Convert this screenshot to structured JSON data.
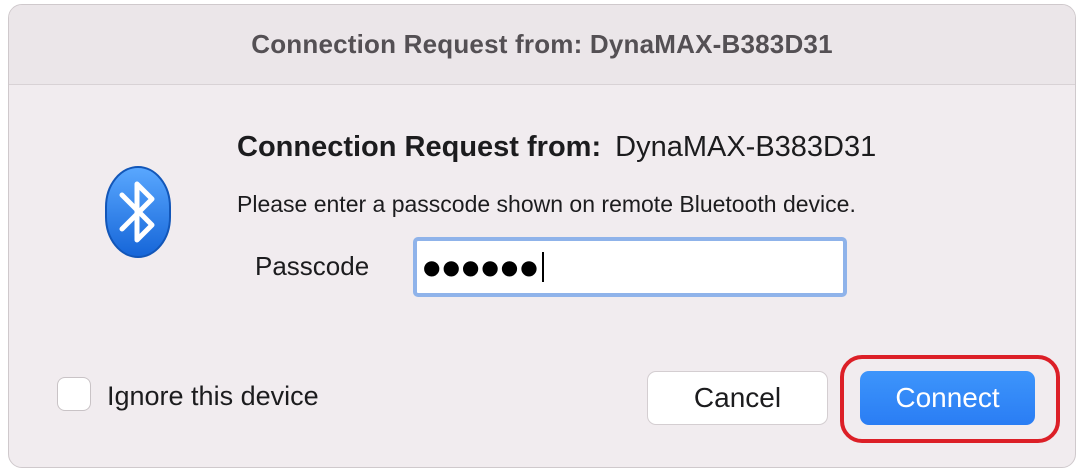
{
  "window": {
    "title": "Connection Request from: DynaMAX-B383D31"
  },
  "dialog": {
    "heading_label": "Connection Request from:",
    "heading_device": "DynaMAX-B383D31",
    "instruction": "Please enter a passcode shown on remote Bluetooth device.",
    "passcode_label": "Passcode",
    "passcode_value": "●●●●●●",
    "icon": "bluetooth-icon"
  },
  "footer": {
    "ignore_label": "Ignore this device",
    "ignore_checked": false,
    "cancel_label": "Cancel",
    "connect_label": "Connect"
  },
  "colors": {
    "accent": "#2a7df4",
    "highlight": "#dc1f27",
    "focus_ring": "#8fb3ea"
  }
}
